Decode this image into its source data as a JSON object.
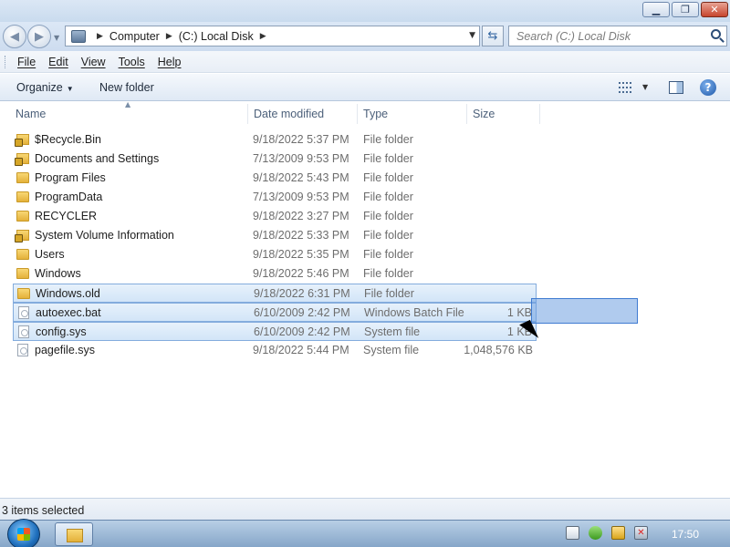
{
  "window": {
    "minimize": "▁",
    "maximize": "❐",
    "close": "✕"
  },
  "address": {
    "crumbs": [
      "Computer",
      "(C:) Local Disk"
    ]
  },
  "search": {
    "placeholder": "Search (C:) Local Disk"
  },
  "menu": [
    "File",
    "Edit",
    "View",
    "Tools",
    "Help"
  ],
  "commands": {
    "organize": "Organize",
    "new_folder": "New folder"
  },
  "columns": {
    "name": "Name",
    "date": "Date modified",
    "type": "Type",
    "size": "Size"
  },
  "files": [
    {
      "name": "$Recycle.Bin",
      "date": "9/18/2022 5:37 PM",
      "type": "File folder",
      "size": "",
      "icon": "locked-folder-icon",
      "selected": false
    },
    {
      "name": "Documents and Settings",
      "date": "7/13/2009 9:53 PM",
      "type": "File folder",
      "size": "",
      "icon": "locked-folder-icon",
      "selected": false
    },
    {
      "name": "Program Files",
      "date": "9/18/2022 5:43 PM",
      "type": "File folder",
      "size": "",
      "icon": "folder-icon",
      "selected": false
    },
    {
      "name": "ProgramData",
      "date": "7/13/2009 9:53 PM",
      "type": "File folder",
      "size": "",
      "icon": "folder-icon",
      "selected": false
    },
    {
      "name": "RECYCLER",
      "date": "9/18/2022 3:27 PM",
      "type": "File folder",
      "size": "",
      "icon": "folder-icon",
      "selected": false
    },
    {
      "name": "System Volume Information",
      "date": "9/18/2022 5:33 PM",
      "type": "File folder",
      "size": "",
      "icon": "locked-folder-icon",
      "selected": false
    },
    {
      "name": "Users",
      "date": "9/18/2022 5:35 PM",
      "type": "File folder",
      "size": "",
      "icon": "folder-icon",
      "selected": false
    },
    {
      "name": "Windows",
      "date": "9/18/2022 5:46 PM",
      "type": "File folder",
      "size": "",
      "icon": "folder-icon",
      "selected": false
    },
    {
      "name": "Windows.old",
      "date": "9/18/2022 6:31 PM",
      "type": "File folder",
      "size": "",
      "icon": "folder-icon",
      "selected": true
    },
    {
      "name": "autoexec.bat",
      "date": "6/10/2009 2:42 PM",
      "type": "Windows Batch File",
      "size": "1 KB",
      "icon": "file-icon",
      "selected": true
    },
    {
      "name": "config.sys",
      "date": "6/10/2009 2:42 PM",
      "type": "System file",
      "size": "1 KB",
      "icon": "file-icon",
      "selected": true
    },
    {
      "name": "pagefile.sys",
      "date": "9/18/2022 5:44 PM",
      "type": "System file",
      "size": "1,048,576 KB",
      "icon": "file-icon",
      "selected": false
    }
  ],
  "status": {
    "text": "3 items selected"
  },
  "taskbar": {
    "clock": "17:50"
  }
}
